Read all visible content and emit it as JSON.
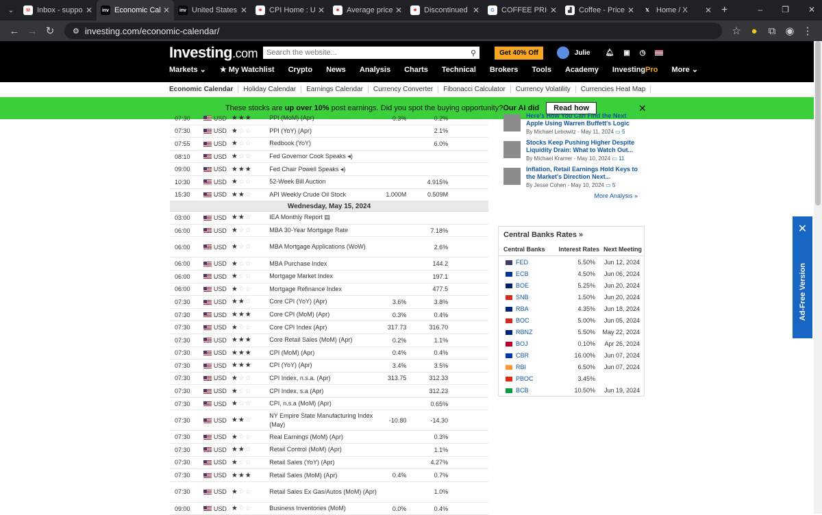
{
  "tabs": [
    {
      "label": "Inbox - support",
      "icon": "gmail-icon",
      "active": false
    },
    {
      "label": "Economic Calen",
      "icon": "investing-icon",
      "active": true
    },
    {
      "label": "United States Co",
      "icon": "investing-icon",
      "active": false
    },
    {
      "label": "CPI Home : U.S.",
      "icon": "bls-icon",
      "active": false
    },
    {
      "label": "Average price se",
      "icon": "bls-icon",
      "active": false
    },
    {
      "label": "Discontinued CP",
      "icon": "bls-icon",
      "active": false
    },
    {
      "label": "COFFEE PRICE O",
      "icon": "google-icon",
      "active": false
    },
    {
      "label": "Coffee - Price -",
      "icon": "tradingeconomics-icon",
      "active": false
    },
    {
      "label": "Home / X",
      "icon": "x-icon",
      "active": false
    }
  ],
  "url": "investing.com/economic-calendar/",
  "site": {
    "brand": "Investing",
    "brand_suffix": ".com",
    "search_placeholder": "Search the website...",
    "promo": "Get 40% Off",
    "user": "Julie"
  },
  "menu": [
    "Markets",
    "My Watchlist",
    "Crypto",
    "News",
    "Analysis",
    "Charts",
    "Technical",
    "Brokers",
    "Tools",
    "Academy",
    "InvestingPro",
    "More"
  ],
  "subnav": [
    "Economic Calendar",
    "Holiday Calendar",
    "Earnings Calendar",
    "Currency Converter",
    "Fibonacci Calculator",
    "Currency Volatility",
    "Currencies Heat Map"
  ],
  "banner": {
    "pre": "These stocks are ",
    "bold": "up over 10%",
    "post": " post earnings. Did you spot the buying opportunity?",
    "ai": " Our AI did",
    "button": "Read how"
  },
  "day_header": "Wednesday, May 15, 2024",
  "rows_before": [
    {
      "time": "07:30",
      "cur": "USD",
      "imp": 3,
      "event": "PPI (MoM) (Apr)",
      "actual": "0.3%",
      "forecast": "0.2%",
      "prev": ""
    },
    {
      "time": "07:30",
      "cur": "USD",
      "imp": 1,
      "event": "PPI (YoY) (Apr)",
      "actual": "",
      "forecast": "2.1%",
      "prev": ""
    },
    {
      "time": "07:55",
      "cur": "USD",
      "imp": 1,
      "event": "Redbook (YoY)",
      "actual": "",
      "forecast": "6.0%",
      "prev": ""
    },
    {
      "time": "08:10",
      "cur": "USD",
      "imp": 1,
      "event": "Fed Governor Cook Speaks ◂)",
      "actual": "",
      "forecast": "",
      "prev": ""
    },
    {
      "time": "09:00",
      "cur": "USD",
      "imp": 3,
      "event": "Fed Chair Powell Speaks ◂)",
      "actual": "",
      "forecast": "",
      "prev": ""
    },
    {
      "time": "10:30",
      "cur": "USD",
      "imp": 1,
      "event": "52-Week Bill Auction",
      "actual": "",
      "forecast": "4.915%",
      "prev": ""
    },
    {
      "time": "15:30",
      "cur": "USD",
      "imp": 2,
      "event": "API Weekly Crude Oil Stock",
      "actual": "1.000M",
      "forecast": "0.509M",
      "prev": ""
    }
  ],
  "rows_after": [
    {
      "time": "03:00",
      "cur": "USD",
      "imp": 2,
      "event": "IEA Monthly Report ▤",
      "actual": "",
      "forecast": "",
      "prev": ""
    },
    {
      "time": "06:00",
      "cur": "USD",
      "imp": 1,
      "event": "MBA 30-Year Mortgage Rate",
      "actual": "",
      "forecast": "7.18%",
      "prev": ""
    },
    {
      "time": "06:00",
      "cur": "USD",
      "imp": 1,
      "event": "MBA Mortgage Applications (WoW)",
      "actual": "",
      "forecast": "2.6%",
      "prev": "",
      "tall": true
    },
    {
      "time": "06:00",
      "cur": "USD",
      "imp": 1,
      "event": "MBA Purchase Index",
      "actual": "",
      "forecast": "144.2",
      "prev": ""
    },
    {
      "time": "06:00",
      "cur": "USD",
      "imp": 1,
      "event": "Mortgage Market Index",
      "actual": "",
      "forecast": "197.1",
      "prev": ""
    },
    {
      "time": "06:00",
      "cur": "USD",
      "imp": 1,
      "event": "Mortgage Refinance Index",
      "actual": "",
      "forecast": "477.5",
      "prev": ""
    },
    {
      "time": "07:30",
      "cur": "USD",
      "imp": 2,
      "event": "Core CPI (YoY) (Apr)",
      "actual": "3.6%",
      "forecast": "3.8%",
      "prev": ""
    },
    {
      "time": "07:30",
      "cur": "USD",
      "imp": 3,
      "event": "Core CPI (MoM) (Apr)",
      "actual": "0.3%",
      "forecast": "0.4%",
      "prev": ""
    },
    {
      "time": "07:30",
      "cur": "USD",
      "imp": 1,
      "event": "Core CPI Index (Apr)",
      "actual": "317.73",
      "forecast": "316.70",
      "prev": ""
    },
    {
      "time": "07:30",
      "cur": "USD",
      "imp": 3,
      "event": "Core Retail Sales (MoM) (Apr)",
      "actual": "0.2%",
      "forecast": "1.1%",
      "prev": ""
    },
    {
      "time": "07:30",
      "cur": "USD",
      "imp": 3,
      "event": "CPI (MoM) (Apr)",
      "actual": "0.4%",
      "forecast": "0.4%",
      "prev": ""
    },
    {
      "time": "07:30",
      "cur": "USD",
      "imp": 3,
      "event": "CPI (YoY) (Apr)",
      "actual": "3.4%",
      "forecast": "3.5%",
      "prev": ""
    },
    {
      "time": "07:30",
      "cur": "USD",
      "imp": 1,
      "event": "CPI Index, n.s.a. (Apr)",
      "actual": "313.75",
      "forecast": "312.33",
      "prev": ""
    },
    {
      "time": "07:30",
      "cur": "USD",
      "imp": 1,
      "event": "CPI Index, s.a (Apr)",
      "actual": "",
      "forecast": "312.23",
      "prev": ""
    },
    {
      "time": "07:30",
      "cur": "USD",
      "imp": 1,
      "event": "CPI, n.s.a (MoM) (Apr)",
      "actual": "",
      "forecast": "0.65%",
      "prev": ""
    },
    {
      "time": "07:30",
      "cur": "USD",
      "imp": 2,
      "event": "NY Empire State Manufacturing Index (May)",
      "actual": "-10.80",
      "forecast": "-14.30",
      "prev": "",
      "tall": true
    },
    {
      "time": "07:30",
      "cur": "USD",
      "imp": 1,
      "event": "Real Earnings (MoM) (Apr)",
      "actual": "",
      "forecast": "0.3%",
      "prev": ""
    },
    {
      "time": "07:30",
      "cur": "USD",
      "imp": 2,
      "event": "Retail Control (MoM) (Apr)",
      "actual": "",
      "forecast": "1.1%",
      "prev": ""
    },
    {
      "time": "07:30",
      "cur": "USD",
      "imp": 1,
      "event": "Retail Sales (YoY) (Apr)",
      "actual": "",
      "forecast": "4.27%",
      "prev": ""
    },
    {
      "time": "07:30",
      "cur": "USD",
      "imp": 3,
      "event": "Retail Sales (MoM) (Apr)",
      "actual": "0.4%",
      "forecast": "0.7%",
      "prev": ""
    },
    {
      "time": "07:30",
      "cur": "USD",
      "imp": 1,
      "event": "Retail Sales Ex Gas/Autos (MoM) (Apr)",
      "actual": "",
      "forecast": "1.0%",
      "prev": "",
      "tall": true
    },
    {
      "time": "09:00",
      "cur": "USD",
      "imp": 1,
      "event": "Business Inventories (MoM)",
      "actual": "0.0%",
      "forecast": "0.4%",
      "prev": ""
    }
  ],
  "news": [
    {
      "title": "Here's How You Can Find the Next Apple Using Warren Buffett's Logic",
      "meta": "By Michael Lebowitz - May 11, 2024",
      "comments": "5"
    },
    {
      "title": "Stocks Keep Pushing Higher Despite Liquidity Drain: What to Watch Out...",
      "meta": "By Michael Kramer - May 10, 2024",
      "comments": "11"
    },
    {
      "title": "Inflation, Retail Earnings Hold Keys to the Market's Direction Next...",
      "meta": "By Jesse Cohen - May 10, 2024",
      "comments": "5"
    }
  ],
  "more_analysis": "More Analysis »",
  "central_banks": {
    "title": "Central Banks Rates »",
    "headers": [
      "Central Banks",
      "Interest Rates",
      "Next Meeting"
    ],
    "rows": [
      {
        "bank": "FED",
        "rate": "5.50%",
        "next": "Jun 12, 2024",
        "color": "#3c3b6e"
      },
      {
        "bank": "ECB",
        "rate": "4.50%",
        "next": "Jun 06, 2024",
        "color": "#003399"
      },
      {
        "bank": "BOE",
        "rate": "5.25%",
        "next": "Jun 20, 2024",
        "color": "#012169"
      },
      {
        "bank": "SNB",
        "rate": "1.50%",
        "next": "Jun 20, 2024",
        "color": "#d52b1e"
      },
      {
        "bank": "RBA",
        "rate": "4.35%",
        "next": "Jun 18, 2024",
        "color": "#00247d"
      },
      {
        "bank": "BOC",
        "rate": "5.00%",
        "next": "Jun 05, 2024",
        "color": "#d52b1e"
      },
      {
        "bank": "RBNZ",
        "rate": "5.50%",
        "next": "May 22, 2024",
        "color": "#00247d"
      },
      {
        "bank": "BOJ",
        "rate": "0.10%",
        "next": "Apr 26, 2024",
        "color": "#bc002d"
      },
      {
        "bank": "CBR",
        "rate": "16.00%",
        "next": "Jun 07, 2024",
        "color": "#0039a6"
      },
      {
        "bank": "RBI",
        "rate": "6.50%",
        "next": "Jun 07, 2024",
        "color": "#ff9933"
      },
      {
        "bank": "PBOC",
        "rate": "3.45%",
        "next": "",
        "color": "#de2910"
      },
      {
        "bank": "BCB",
        "rate": "10.50%",
        "next": "Jun 19, 2024",
        "color": "#009c3b"
      }
    ]
  },
  "adfree_label": "Ad-Free Version"
}
